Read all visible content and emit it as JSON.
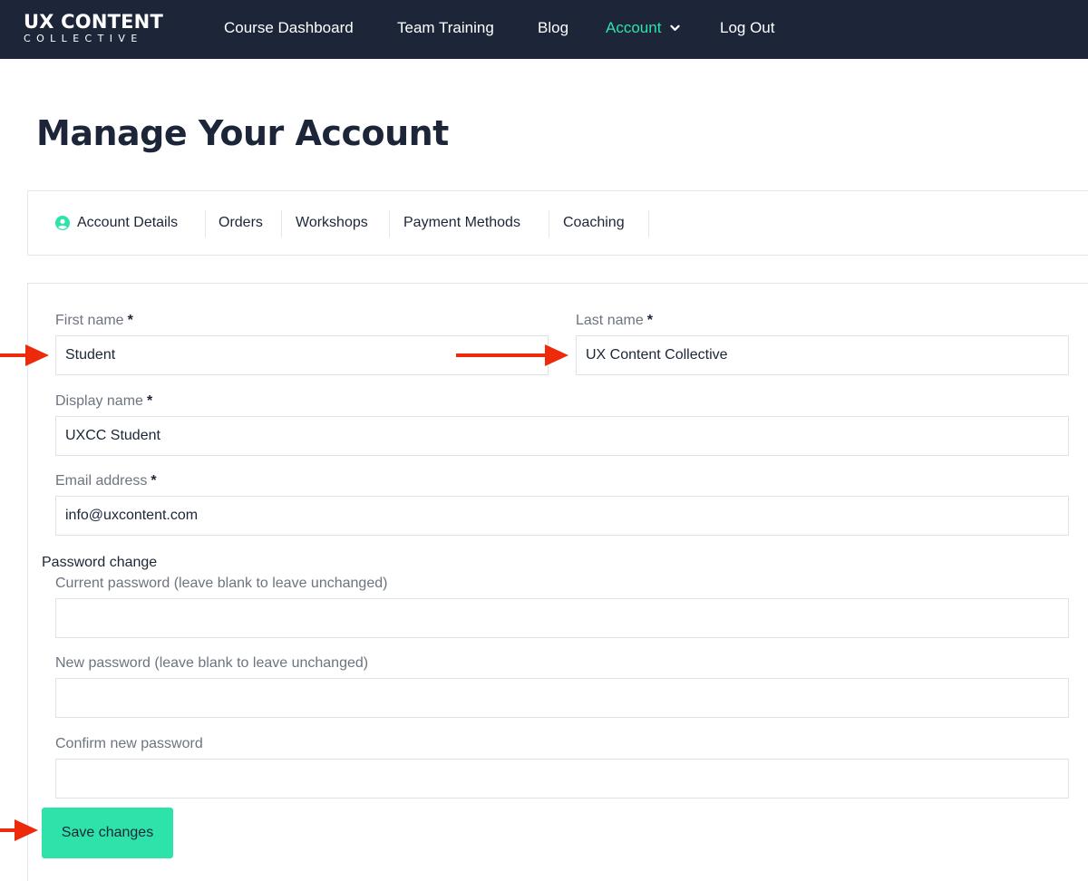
{
  "header": {
    "logo_main": "UX CONTENT",
    "logo_sub": "COLLECTIVE",
    "nav": {
      "course_dashboard": "Course Dashboard",
      "team_training": "Team Training",
      "blog": "Blog",
      "account": "Account",
      "log_out": "Log Out"
    }
  },
  "page": {
    "title": "Manage Your Account"
  },
  "tabs": {
    "account_details": "Account Details",
    "orders": "Orders",
    "workshops": "Workshops",
    "payment_methods": "Payment Methods",
    "coaching": "Coaching"
  },
  "form": {
    "first_name": {
      "label": "First name",
      "required": "*",
      "value": "Student"
    },
    "last_name": {
      "label": "Last name",
      "required": "*",
      "value": "UX Content Collective"
    },
    "display_name": {
      "label": "Display name",
      "required": "*",
      "value": "UXCC Student"
    },
    "email": {
      "label": "Email address",
      "required": "*",
      "value": "info@uxcontent.com"
    },
    "password_section": "Password change",
    "current_password": {
      "label": "Current password (leave blank to leave unchanged)",
      "value": ""
    },
    "new_password": {
      "label": "New password (leave blank to leave unchanged)",
      "value": ""
    },
    "confirm_password": {
      "label": "Confirm new password",
      "value": ""
    },
    "save_label": "Save changes"
  },
  "icons": {
    "account_tab": "user-circle-icon",
    "dropdown": "chevron-down-icon",
    "annotation": "red-arrow-icon"
  },
  "colors": {
    "nav_background": "#1c2638",
    "accent": "#2de3a9",
    "annotation_arrow": "#ee2a0c"
  }
}
